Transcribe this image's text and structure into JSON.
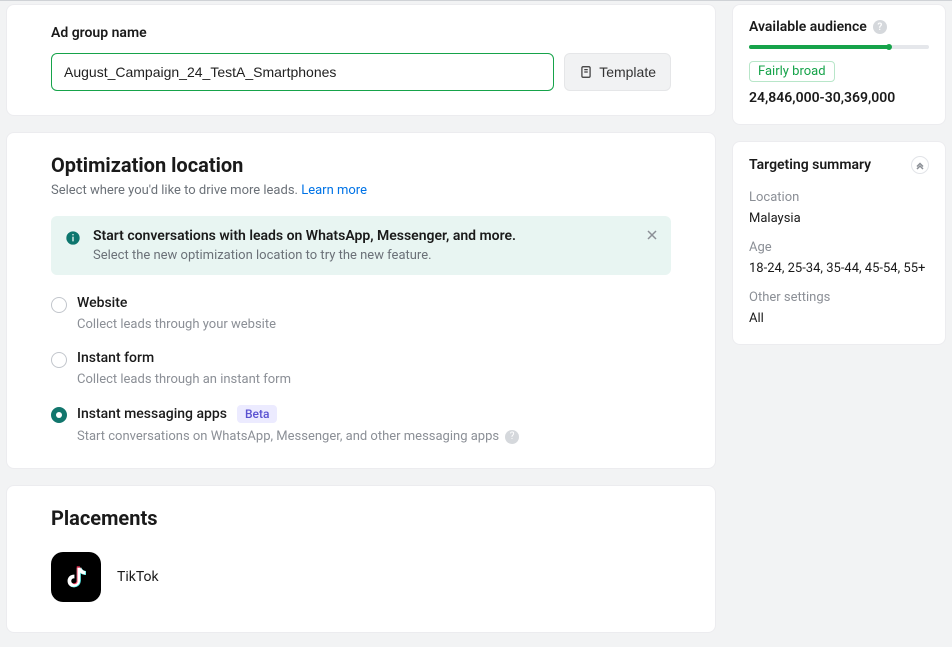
{
  "adGroup": {
    "label": "Ad group name",
    "value": "August_Campaign_24_TestA_Smartphones",
    "templateLabel": "Template"
  },
  "optimization": {
    "title": "Optimization location",
    "subtitle": "Select where you'd like to drive more leads.",
    "learnMore": "Learn more",
    "banner": {
      "title": "Start conversations with leads on WhatsApp, Messenger, and more.",
      "body": "Select the new optimization location to try the new feature."
    },
    "options": [
      {
        "title": "Website",
        "desc": "Collect leads through your website",
        "selected": false,
        "badge": null,
        "descHelp": false
      },
      {
        "title": "Instant form",
        "desc": "Collect leads through an instant form",
        "selected": false,
        "badge": null,
        "descHelp": false
      },
      {
        "title": "Instant messaging apps",
        "desc": "Start conversations on WhatsApp, Messenger, and other messaging apps",
        "selected": true,
        "badge": "Beta",
        "descHelp": true
      }
    ]
  },
  "placements": {
    "title": "Placements",
    "items": [
      {
        "label": "TikTok"
      }
    ]
  },
  "audience": {
    "title": "Available audience",
    "tag": "Fairly broad",
    "range": "24,846,000-30,369,000",
    "fillPercent": 78
  },
  "targeting": {
    "title": "Targeting summary",
    "location": {
      "label": "Location",
      "value": "Malaysia"
    },
    "age": {
      "label": "Age",
      "value": "18-24, 25-34, 35-44, 45-54, 55+"
    },
    "other": {
      "label": "Other settings",
      "value": "All"
    }
  }
}
